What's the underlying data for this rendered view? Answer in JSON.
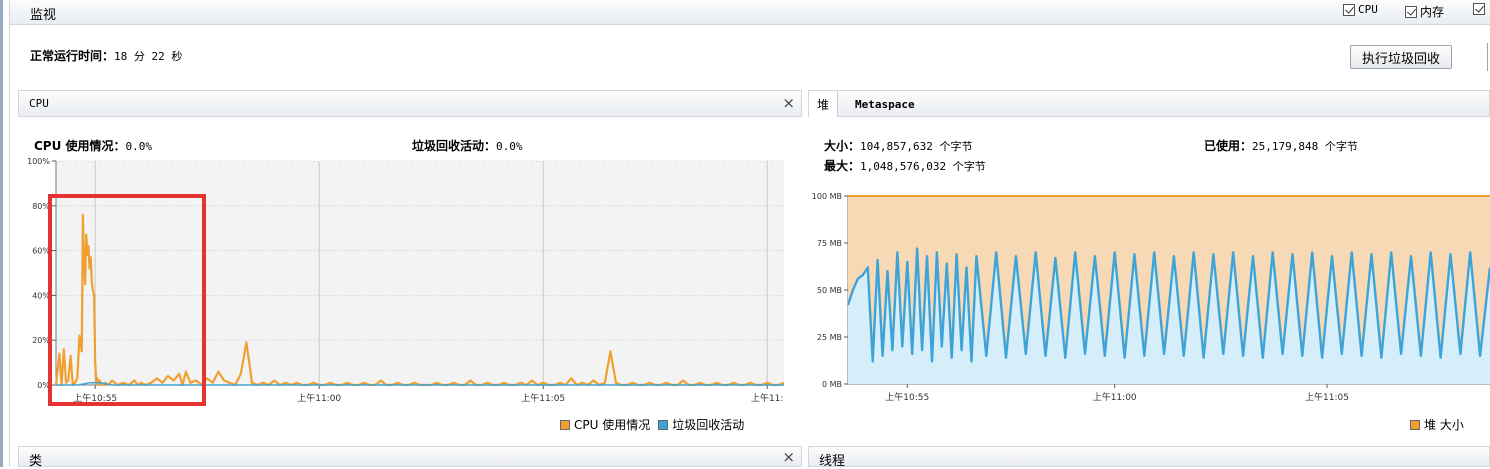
{
  "header": {
    "title": "监视"
  },
  "checkboxes": [
    {
      "label": "CPU",
      "checked": true
    },
    {
      "label": "内存",
      "checked": true
    }
  ],
  "uptime": {
    "label": "正常运行时间：",
    "value": "18 分 22 秒"
  },
  "gc_button": {
    "label": "执行垃圾回收"
  },
  "cpu_panel": {
    "title": "CPU",
    "close": "×",
    "usage_label": "CPU 使用情况：",
    "usage_value": "0.0%",
    "gc_label": "垃圾回收活动：",
    "gc_value": "0.0%",
    "legend": [
      {
        "label": "CPU 使用情况",
        "color": "#f0a030"
      },
      {
        "label": "垃圾回收活动",
        "color": "#3ea4d8"
      }
    ]
  },
  "heap_panel": {
    "tabs": [
      "堆",
      "Metaspace"
    ],
    "size_label": "大小：",
    "size_value": "104,857,632 个字节",
    "used_label": "已使用：",
    "used_value": "25,179,848 个字节",
    "max_label": "最大：",
    "max_value": "1,048,576,032 个字节",
    "legend": [
      {
        "label": "堆 大小",
        "color": "#f0a030"
      }
    ]
  },
  "bottom_panels": {
    "classes_title": "类",
    "threads_title": "线程",
    "close": "×"
  },
  "colors": {
    "cpu": "#f0a030",
    "gc": "#3ea4d8",
    "highlight": "#e53333"
  },
  "chart_data": [
    {
      "type": "line",
      "title": "",
      "xlabel": "",
      "ylabel": "",
      "x_tick_labels": [
        "上午10:55",
        "上午11:00",
        "上午11:05",
        "上午11:"
      ],
      "y_tick_labels": [
        "100%",
        "80%",
        "60%",
        "40%",
        "20%",
        "0%"
      ],
      "ylim": [
        0,
        100
      ],
      "grid": true,
      "series": [
        {
          "name": "CPU 使用情况",
          "color": "#f0a030",
          "x": [
            0,
            0.3,
            0.5,
            0.7,
            0.9,
            1.1,
            1.3,
            1.5,
            1.7,
            1.9,
            2.1,
            2.3,
            2.4,
            2.5,
            2.6,
            2.7,
            2.8,
            2.9,
            3.0,
            3.1,
            3.2,
            3.3,
            3.4,
            3.5,
            3.6,
            3.7,
            3.8,
            3.9,
            4.0,
            4.2,
            4.4,
            4.7,
            5.0,
            5.5,
            6.0,
            6.5,
            7.0,
            7.3,
            7.6,
            8.0,
            8.5,
            9.0,
            9.5,
            10.0,
            10.5,
            11.0,
            11.3,
            11.6,
            12.0,
            12.5,
            13.0,
            13.5,
            14.0,
            14.5,
            15.0,
            15.5,
            16.0,
            16.5,
            17.0,
            17.5,
            18.0,
            18.5,
            19.0,
            19.5,
            20.0,
            20.5,
            21.0,
            21.5,
            22.0,
            22.5,
            23.0,
            23.5,
            24.0,
            24.5,
            25.0,
            25.5,
            26.0,
            26.5,
            27.0,
            27.5,
            28.0,
            28.5,
            29.0,
            29.5,
            30.0,
            30.5,
            31.0,
            31.5,
            32.0,
            32.5,
            33.0,
            33.5,
            34.0,
            34.5,
            35.0,
            35.5,
            36.0,
            36.5,
            37.0,
            37.5,
            38.0,
            38.5,
            39.0,
            39.5,
            40.0,
            40.5,
            41.0,
            41.5,
            42.0,
            42.5,
            43.0,
            43.5,
            44.0,
            44.5,
            45.0,
            45.5,
            46.0,
            46.5,
            47.0,
            47.5,
            48.0,
            48.5,
            49.0,
            49.5,
            50.0,
            50.5,
            51.0,
            51.5,
            52.0,
            52.5,
            53.0,
            53.5,
            54.0,
            54.5,
            55.0,
            55.5,
            56.0,
            56.5,
            57.0,
            57.5,
            58.0,
            58.5,
            59.0,
            59.5,
            60.0,
            60.5,
            61.0,
            61.5,
            62.0,
            62.5,
            63.0,
            63.5,
            64.0,
            64.5,
            65.0
          ],
          "values": [
            0,
            14,
            0,
            16,
            1,
            2,
            13,
            0,
            1,
            3,
            22,
            15,
            76,
            55,
            45,
            67,
            58,
            62,
            52,
            57,
            46,
            42,
            40,
            10,
            1,
            3,
            0,
            2,
            1,
            0,
            1,
            0,
            2,
            0,
            1,
            0,
            2,
            0,
            1,
            0,
            1,
            3,
            1,
            4,
            2,
            5,
            0,
            6,
            1,
            2,
            0,
            3,
            1,
            6,
            2,
            1,
            0,
            5,
            19,
            1,
            0,
            1,
            0,
            2,
            0,
            1,
            0,
            1,
            0,
            0,
            1,
            0,
            0,
            1,
            0,
            0,
            1,
            0,
            0,
            1,
            0,
            0,
            2,
            0,
            0,
            1,
            0,
            0,
            1,
            0,
            0,
            0,
            1,
            0,
            0,
            1,
            0,
            0,
            2,
            0,
            0,
            1,
            0,
            0,
            1,
            0,
            0,
            1,
            0,
            2,
            0,
            1,
            0,
            0,
            1,
            0,
            3,
            0,
            1,
            0,
            2,
            0,
            1,
            15,
            1,
            0,
            0,
            1,
            0,
            0,
            1,
            0,
            0,
            1,
            0,
            0,
            2,
            0,
            0,
            1,
            0,
            0,
            1,
            0,
            0,
            1,
            0,
            0,
            1,
            0,
            0,
            1,
            0,
            0,
            1
          ]
        },
        {
          "name": "垃圾回收活动",
          "color": "#3ea4d8",
          "x": [
            0,
            2,
            3,
            4,
            5,
            65
          ],
          "values": [
            0,
            0,
            1,
            1,
            0,
            0
          ]
        }
      ]
    },
    {
      "type": "area",
      "title": "",
      "xlabel": "",
      "ylabel": "",
      "x_tick_labels": [
        "上午10:55",
        "上午11:00",
        "上午11:05"
      ],
      "y_tick_labels": [
        "100 MB",
        "75 MB",
        "50 MB",
        "25 MB",
        "0 MB"
      ],
      "ylim": [
        0,
        100
      ],
      "grid": true,
      "series": [
        {
          "name": "堆 大小",
          "color": "#f0a030",
          "x": [
            0,
            65
          ],
          "values": [
            100,
            100
          ]
        },
        {
          "name": "已使用",
          "color": "#3ea4d8",
          "x": [
            0,
            0.5,
            1,
            1.5,
            2,
            2.5,
            3,
            3.5,
            4,
            4.5,
            5,
            5.5,
            6,
            6.5,
            7,
            7.5,
            8,
            8.5,
            9,
            9.5,
            10,
            10.5,
            11,
            11.5,
            12,
            12.5,
            13,
            14,
            15,
            16,
            17,
            18,
            19,
            20,
            21,
            22,
            23,
            24,
            25,
            26,
            27,
            28,
            29,
            30,
            31,
            32,
            33,
            34,
            35,
            36,
            37,
            38,
            39,
            40,
            41,
            42,
            43,
            44,
            45,
            46,
            47,
            48,
            49,
            50,
            51,
            52,
            53,
            54,
            55,
            56,
            57,
            58,
            59,
            60,
            61,
            62,
            63,
            64,
            65
          ],
          "values": [
            42,
            50,
            56,
            58,
            62,
            12,
            66,
            15,
            60,
            18,
            70,
            20,
            65,
            16,
            72,
            18,
            68,
            12,
            70,
            20,
            64,
            14,
            69,
            18,
            62,
            12,
            68,
            15,
            70,
            14,
            68,
            16,
            70,
            15,
            67,
            14,
            70,
            16,
            68,
            15,
            70,
            14,
            69,
            15,
            70,
            16,
            68,
            15,
            70,
            14,
            69,
            16,
            70,
            15,
            68,
            14,
            70,
            16,
            69,
            15,
            70,
            14,
            68,
            16,
            70,
            15,
            69,
            14,
            70,
            16,
            68,
            15,
            70,
            14,
            69,
            16,
            70,
            15,
            62
          ]
        }
      ]
    }
  ]
}
